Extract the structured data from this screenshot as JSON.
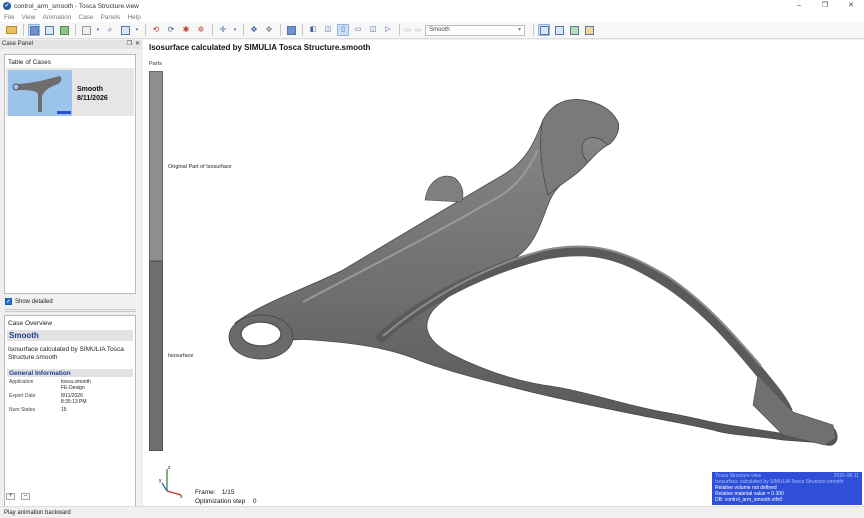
{
  "window": {
    "title": "control_arm_smooth - Tosca Structure.view",
    "minimize": "–",
    "maximize": "❐",
    "close": "✕"
  },
  "menu": [
    "File",
    "View",
    "Animation",
    "Case",
    "Panels",
    "Help"
  ],
  "toolbar": {
    "case_select_value": "Smooth"
  },
  "case_panel": {
    "title": "Case Panel",
    "table_of_cases_title": "Table of Cases",
    "case": {
      "name": "Smooth",
      "date": "8/11/2026"
    },
    "show_detailed": "Show detailed",
    "overview": {
      "title": "Case Overview",
      "name": "Smooth",
      "description": "Isosurface calculated by SIMULIA Tosca Structure.smooth",
      "general_heading": "General Information",
      "rows": [
        {
          "key": "Application",
          "value": "tosca.smooth\nFE-Design"
        },
        {
          "key": "Export Date",
          "value": "8/11/2026\n8:35:13 PM"
        },
        {
          "key": "Num States",
          "value": "15"
        }
      ]
    },
    "add_label": "+",
    "remove_label": "–"
  },
  "viewport": {
    "title": "Isosurface calculated by SIMULIA Tosca Structure.smooth",
    "legend": {
      "title": "Parts",
      "label_original": "Original Part of Isosurface",
      "label_iso": "Isosurface"
    },
    "frame_label": "Frame:",
    "frame_value": "1/15",
    "step_label": "Optimization step",
    "step_value": "0",
    "axes": {
      "x": "x",
      "y": "y",
      "z": "z"
    },
    "info_box": {
      "line1": "Tosca Structure.view",
      "date": "2026-08-11",
      "line2": "Isosurface calculated by SIMULIA Tosca Structure.smooth",
      "line3": "Relative volume not defined",
      "line4": "Relative material value = 0.300",
      "line5": "DB:   control_arm_smooth.vtfx0"
    }
  },
  "statusbar": {
    "text": "Play animation backward"
  },
  "colors": {
    "accent": "#1e6fd1",
    "info_box_bg": "#2f4fd8",
    "model_grey": "#7a7a7a",
    "thumb_bg": "#9cc3ea"
  }
}
